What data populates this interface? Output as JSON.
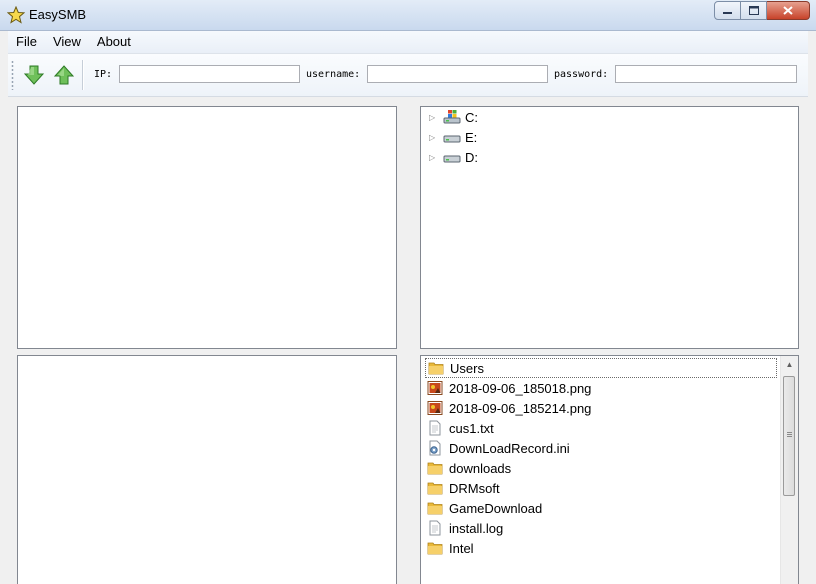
{
  "window": {
    "title": "EasySMB"
  },
  "menu": {
    "items": [
      "File",
      "View",
      "About"
    ]
  },
  "toolbar": {
    "download_icon": "download-arrow-icon",
    "upload_icon": "upload-arrow-icon",
    "ip_label": "IP:",
    "ip_value": "",
    "username_label": "username:",
    "username_value": "",
    "password_label": "password:",
    "password_value": ""
  },
  "drive_tree": {
    "items": [
      {
        "label": "C:",
        "icon": "system-drive-icon"
      },
      {
        "label": "E:",
        "icon": "drive-icon"
      },
      {
        "label": "D:",
        "icon": "drive-icon"
      }
    ]
  },
  "file_list": {
    "items": [
      {
        "label": "Users",
        "icon": "folder-icon"
      },
      {
        "label": "2018-09-06_185018.png",
        "icon": "image-file-icon"
      },
      {
        "label": "2018-09-06_185214.png",
        "icon": "image-file-icon"
      },
      {
        "label": "cus1.txt",
        "icon": "text-file-icon"
      },
      {
        "label": "DownLoadRecord.ini",
        "icon": "settings-file-icon"
      },
      {
        "label": "downloads",
        "icon": "folder-icon"
      },
      {
        "label": "DRMsoft",
        "icon": "folder-icon"
      },
      {
        "label": "GameDownload",
        "icon": "folder-icon"
      },
      {
        "label": "install.log",
        "icon": "text-file-icon"
      },
      {
        "label": "Intel",
        "icon": "folder-icon"
      }
    ]
  },
  "colors": {
    "title_bar": "#c9d9ee",
    "close_button": "#c7432a",
    "panel_border": "#828790"
  }
}
